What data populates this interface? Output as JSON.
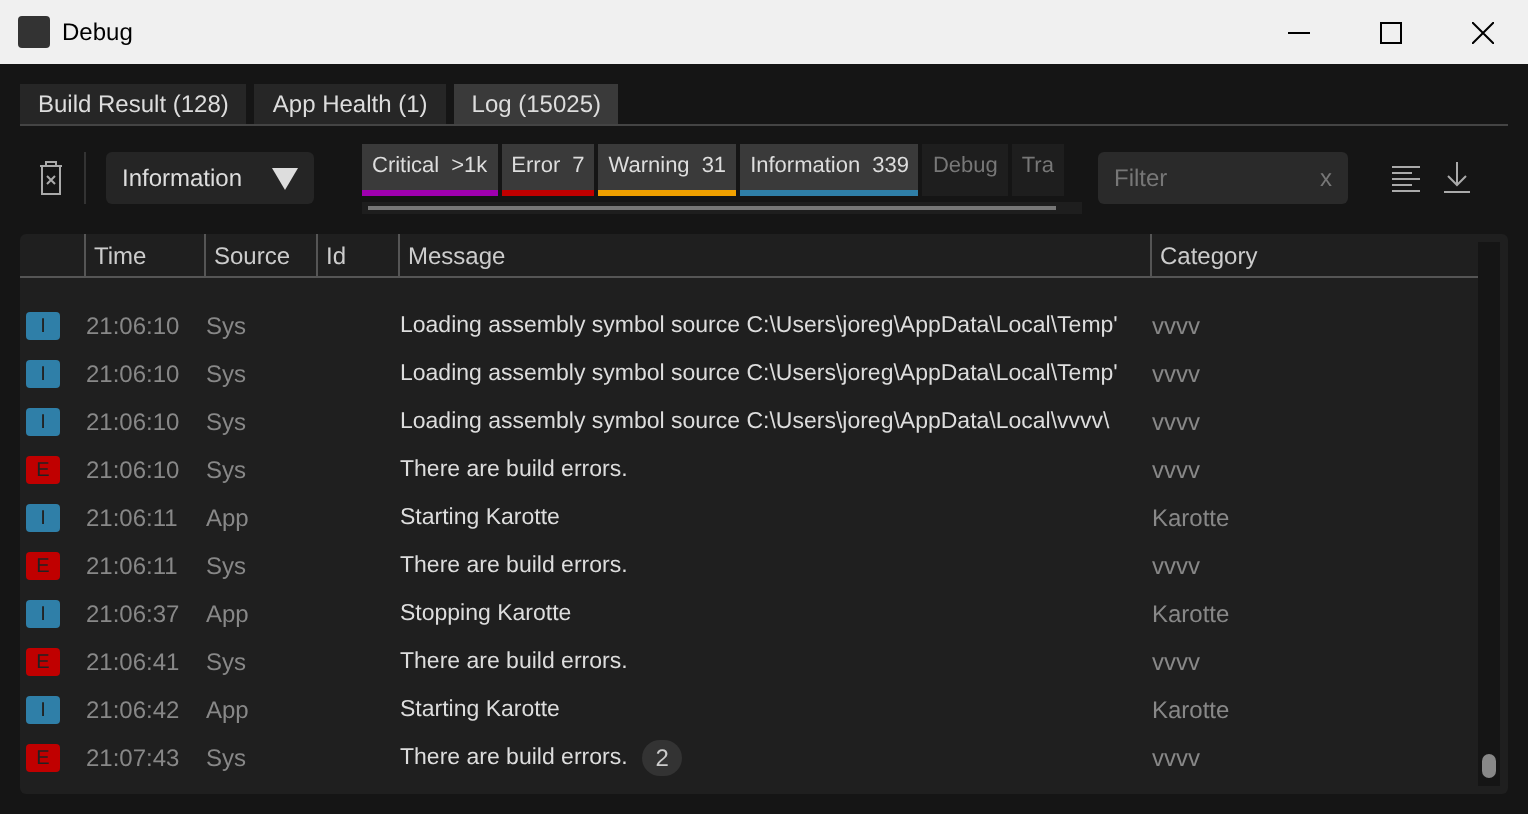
{
  "window": {
    "title": "Debug"
  },
  "tabs": [
    {
      "label": "Build Result (128)",
      "selected": false
    },
    {
      "label": "App Health (1)",
      "selected": false
    },
    {
      "label": "Log (15025)",
      "selected": true
    }
  ],
  "toolbar": {
    "level_dropdown": "Information",
    "filter": {
      "placeholder": "Filter",
      "clear": "x"
    }
  },
  "level_chips": [
    {
      "label": "Critical",
      "count": ">1k",
      "color": "#a000b0",
      "selected": true
    },
    {
      "label": "Error",
      "count": "7",
      "color": "#c00000",
      "selected": true
    },
    {
      "label": "Warning",
      "count": "31",
      "color": "#f0a000",
      "selected": true
    },
    {
      "label": "Information",
      "count": "339",
      "color": "#2f7fa8",
      "selected": true
    },
    {
      "label": "Debug",
      "selected": false
    },
    {
      "label": "Tra",
      "selected": false
    }
  ],
  "table": {
    "columns": [
      "Time",
      "Source",
      "Id",
      "Message",
      "Category"
    ],
    "rows": [
      {
        "level": "I",
        "kind": "info",
        "time": "21:06:10",
        "source": "Sys",
        "message": "Loading assembly symbol source C:\\Users\\joreg\\AppData\\Local\\Temp'",
        "category": "vvvv"
      },
      {
        "level": "I",
        "kind": "info",
        "time": "21:06:10",
        "source": "Sys",
        "message": "Loading assembly symbol source C:\\Users\\joreg\\AppData\\Local\\Temp'",
        "category": "vvvv"
      },
      {
        "level": "I",
        "kind": "info",
        "time": "21:06:10",
        "source": "Sys",
        "message": "Loading assembly symbol source C:\\Users\\joreg\\AppData\\Local\\vvvv\\",
        "category": "vvvv"
      },
      {
        "level": "E",
        "kind": "error",
        "time": "21:06:10",
        "source": "Sys",
        "message": "There are build errors.",
        "category": "vvvv"
      },
      {
        "level": "I",
        "kind": "info",
        "time": "21:06:11",
        "source": "App",
        "message": "Starting Karotte",
        "category": "Karotte"
      },
      {
        "level": "E",
        "kind": "error",
        "time": "21:06:11",
        "source": "Sys",
        "message": "There are build errors.",
        "category": "vvvv"
      },
      {
        "level": "I",
        "kind": "info",
        "time": "21:06:37",
        "source": "App",
        "message": "Stopping Karotte",
        "category": "Karotte"
      },
      {
        "level": "E",
        "kind": "error",
        "time": "21:06:41",
        "source": "Sys",
        "message": "There are build errors.",
        "category": "vvvv"
      },
      {
        "level": "I",
        "kind": "info",
        "time": "21:06:42",
        "source": "App",
        "message": "Starting Karotte",
        "category": "Karotte"
      },
      {
        "level": "E",
        "kind": "error",
        "time": "21:07:43",
        "source": "Sys",
        "message": "There are build errors.",
        "repeat": "2",
        "category": "vvvv"
      }
    ]
  }
}
